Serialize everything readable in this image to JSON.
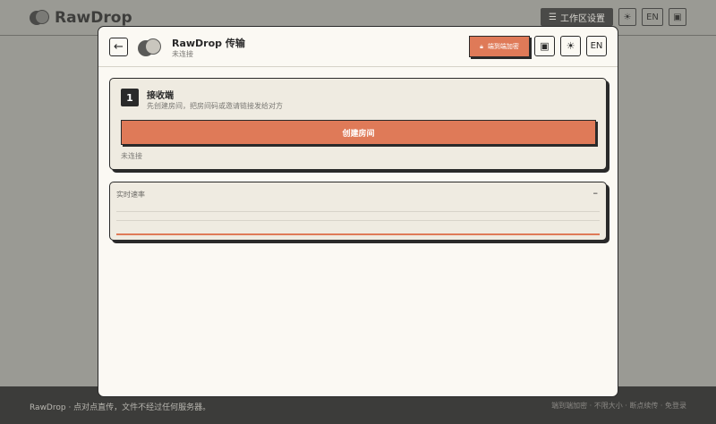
{
  "background": {
    "app_name": "RawDrop",
    "workspace_btn": "工作区设置",
    "lang_btn": "EN",
    "footer_left": "RawDrop · 点对点直传，文件不经过任何服务器。",
    "footer_right": "端到端加密 · 不限大小 · 断点续传 · 免登录"
  },
  "modal": {
    "title": "RawDrop 传输",
    "subtitle": "未连接",
    "lock_label": "端到端加密",
    "lang_label": "EN"
  },
  "receiver": {
    "step": "1",
    "title": "接收端",
    "description": "先创建房间，把房间码或邀请链接发给对方",
    "create_button": "创建房间",
    "status": "未连接"
  },
  "speed": {
    "label": "实时速率",
    "value": "–"
  },
  "colors": {
    "accent": "#df7a58",
    "dark": "#2a2a2a",
    "card_bg": "#efebe1",
    "modal_bg": "#fbf9f3"
  },
  "icons": {
    "back": "arrow-left-icon",
    "lock": "lock-icon",
    "archive": "archive-icon",
    "theme": "sun-icon",
    "settings": "sliders-icon"
  }
}
